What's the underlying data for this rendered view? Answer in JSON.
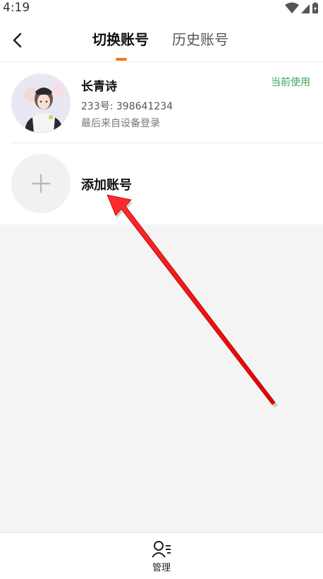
{
  "status_bar": {
    "time": "4:19",
    "icons": [
      "wifi-icon",
      "signal-icon",
      "battery-charging-icon"
    ]
  },
  "header": {
    "back_icon": "chevron-left-icon",
    "tabs": [
      {
        "label": "切换账号",
        "active": true
      },
      {
        "label": "历史账号",
        "active": false
      }
    ],
    "accent_color": "#f07a1c"
  },
  "accounts": [
    {
      "name": "长青诗",
      "id_text": "233号: 398641234",
      "login_text": "最后来自设备登录",
      "badge": "当前使用",
      "badge_color": "#3ba55c"
    }
  ],
  "add_account": {
    "label": "添加账号",
    "icon": "plus-icon"
  },
  "bottom_bar": {
    "manage_label": "管理",
    "manage_icon": "user-manage-icon"
  }
}
